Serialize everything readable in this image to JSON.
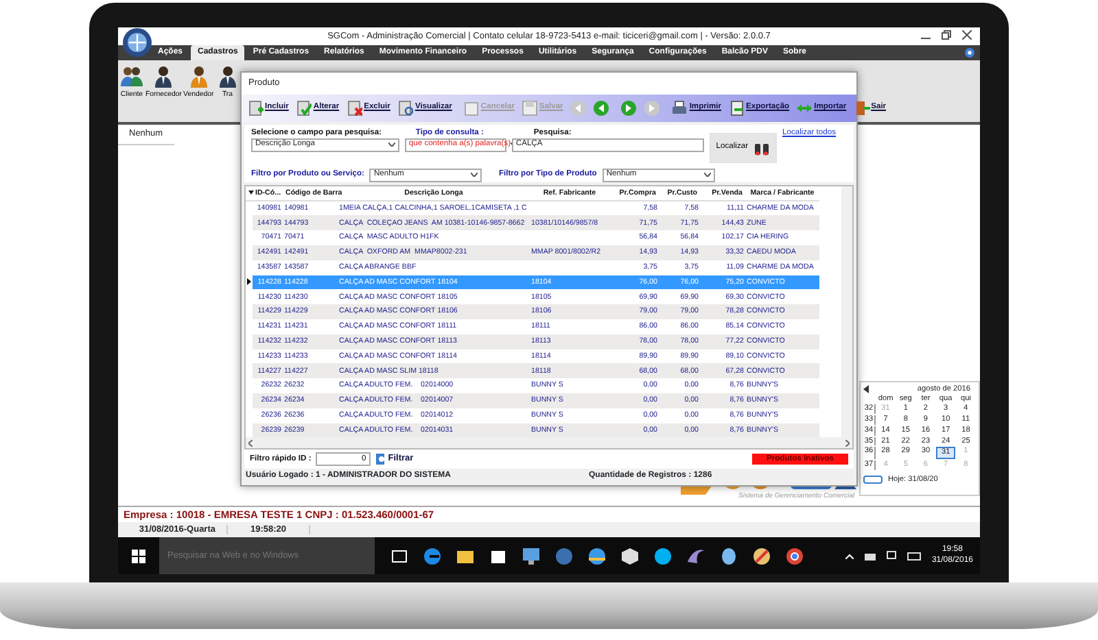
{
  "app": {
    "title": "SGCom - Administração Comercial | Contato celular 18-9723-5413 e-mail: ticiceri@gmail.com | - Versão: 2.0.0.7",
    "menu": [
      {
        "label": "Ações",
        "selected": false
      },
      {
        "label": "Cadastros",
        "selected": true
      },
      {
        "label": "Pré Cadastros",
        "selected": false
      },
      {
        "label": "Relatórios",
        "selected": false
      },
      {
        "label": "Movimento Financeiro",
        "selected": false
      },
      {
        "label": "Processos",
        "selected": false
      },
      {
        "label": "Utilitários",
        "selected": false
      },
      {
        "label": "Segurança",
        "selected": false
      },
      {
        "label": "Configurações",
        "selected": false
      },
      {
        "label": "Balcão PDV",
        "selected": false
      },
      {
        "label": "Sobre",
        "selected": false
      }
    ],
    "ribbon": [
      {
        "label": "Cliente",
        "kind": "people"
      },
      {
        "label": "Fornecedor",
        "kind": "person"
      },
      {
        "label": "Vendedor",
        "kind": "seller"
      },
      {
        "label": "Tra",
        "kind": "person"
      }
    ]
  },
  "mdi_label": "Nenhum",
  "product_window": {
    "title": "Produto",
    "toolbar": [
      {
        "kind": "add",
        "label": "Incluir",
        "disabled": false
      },
      {
        "kind": "edit",
        "label": "Alterar",
        "disabled": false
      },
      {
        "kind": "delete",
        "label": "Excluir",
        "disabled": false
      },
      {
        "kind": "view",
        "label": "Visualizar",
        "disabled": false
      },
      {
        "kind": "cancel",
        "label": "Cancelar",
        "disabled": true
      },
      {
        "kind": "save",
        "label": "Salvar",
        "disabled": true
      },
      {
        "kind": "first",
        "disabled": true
      },
      {
        "kind": "prev",
        "disabled": false
      },
      {
        "kind": "next",
        "disabled": false
      },
      {
        "kind": "last",
        "disabled": true
      },
      {
        "kind": "print",
        "label": "Imprimir",
        "disabled": false
      },
      {
        "kind": "export",
        "label": "Exportação",
        "disabled": false
      },
      {
        "kind": "import",
        "label": "Importar",
        "disabled": false
      },
      {
        "kind": "exit",
        "label": "Sair",
        "disabled": false
      }
    ],
    "search": {
      "field_label": "Selecione o campo para pesquisa:",
      "field_value": "Descrição Longa",
      "type_label": "Tipo de consulta :",
      "type_value": "que contenha a(s) palavra(s)",
      "query_label": "Pesquisa:",
      "query_value": "CALÇA",
      "find_button": "Localizar",
      "find_all_link": "Localizar todos",
      "filter1_label": "Filtro por Produto ou Serviço:",
      "filter1_value": "Nenhum",
      "filter2_label": "Filtro por Tipo de Produto",
      "filter2_value": "Nenhum"
    },
    "table": {
      "columns": [
        "ID-Có...",
        "Código de Barra",
        "Descrição Longa",
        "Ref. Fabricante",
        "Pr.Compra",
        "Pr.Custo",
        "Pr.Venda",
        "Marca / Fabricante"
      ],
      "rows": [
        {
          "selected": false,
          "cells": [
            "140981",
            "140981",
            "1MEIA CALÇA,1 CALCINHA,1 SAROEL,1CAMISETA ,1 C",
            "",
            "7,58",
            "7,58",
            "11,11",
            "CHARME DA MODA"
          ]
        },
        {
          "selected": false,
          "cells": [
            "144793",
            "144793",
            "CALÇA  COLEÇAO JEANS  AM 10381-10146-9857-8662",
            "10381/10146/9857/8",
            "71,75",
            "71,75",
            "144,43",
            "ZUNE"
          ]
        },
        {
          "selected": false,
          "cells": [
            "70471",
            "70471",
            "CALÇA  MASC ADULTO H1FK",
            "",
            "56,84",
            "56,84",
            "102,17",
            "CIA HERING"
          ]
        },
        {
          "selected": false,
          "cells": [
            "142491",
            "142491",
            "CALÇA  OXFORD AM  MMAP8002-231",
            "MMAP 8001/8002/R2",
            "14,93",
            "14,93",
            "33,32",
            "CAEDU MODA"
          ]
        },
        {
          "selected": false,
          "cells": [
            "143587",
            "143587",
            "CALÇA ABRANGE BBF",
            "",
            "3,75",
            "3,75",
            "11,09",
            "CHARME DA MODA"
          ]
        },
        {
          "selected": true,
          "cells": [
            "114228",
            "114228",
            "CALÇA AD MASC CONFORT 18104",
            "18104",
            "76,00",
            "76,00",
            "75,20",
            "CONVICTO"
          ]
        },
        {
          "selected": false,
          "cells": [
            "114230",
            "114230",
            "CALÇA AD MASC CONFORT 18105",
            "18105",
            "69,90",
            "69,90",
            "69,30",
            "CONVICTO"
          ]
        },
        {
          "selected": false,
          "cells": [
            "114229",
            "114229",
            "CALÇA AD MASC CONFORT 18106",
            "18106",
            "79,00",
            "79,00",
            "78,28",
            "CONVICTO"
          ]
        },
        {
          "selected": false,
          "cells": [
            "114231",
            "114231",
            "CALÇA AD MASC CONFORT 18111",
            "18111",
            "86,00",
            "86,00",
            "85,14",
            "CONVICTO"
          ]
        },
        {
          "selected": false,
          "cells": [
            "114232",
            "114232",
            "CALÇA AD MASC CONFORT 18113",
            "18113",
            "78,00",
            "78,00",
            "77,22",
            "CONVICTO"
          ]
        },
        {
          "selected": false,
          "cells": [
            "114233",
            "114233",
            "CALÇA AD MASC CONFORT 18114",
            "18114",
            "89,90",
            "89,90",
            "89,10",
            "CONVICTO"
          ]
        },
        {
          "selected": false,
          "cells": [
            "114227",
            "114227",
            "CALÇA AD MASC SLIM 18118",
            "18118",
            "68,00",
            "68,00",
            "67,28",
            "CONVICTO"
          ]
        },
        {
          "selected": false,
          "cells": [
            "26232",
            "26232",
            "CALÇA ADULTO FEM.    02014000",
            "BUNNY S",
            "0,00",
            "0,00",
            "8,76",
            "BUNNY'S"
          ]
        },
        {
          "selected": false,
          "cells": [
            "26234",
            "26234",
            "CALÇA ADULTO FEM.    02014007",
            "BUNNY S",
            "0,00",
            "0,00",
            "8,76",
            "BUNNY'S"
          ]
        },
        {
          "selected": false,
          "cells": [
            "26236",
            "26236",
            "CALÇA ADULTO FEM.    02014012",
            "BUNNY S",
            "0,00",
            "0,00",
            "8,76",
            "BUNNY'S"
          ]
        },
        {
          "selected": false,
          "cells": [
            "26239",
            "26239",
            "CALÇA ADULTO FEM.    02014031",
            "BUNNY S",
            "0,00",
            "0,00",
            "8,76",
            "BUNNY'S"
          ]
        }
      ]
    },
    "footer": {
      "quick_filter_label": "Filtro rápido ID :",
      "quick_filter_value": "0",
      "filter_button": "Filtrar",
      "inactive_button": "Produtos Inativos"
    },
    "status": {
      "user": "Usuário Logado : 1 - ADMINISTRADOR DO SISTEMA",
      "count": "Quantidade de Registros : 1286"
    }
  },
  "logo_subtitle": "Sistema de Gerenciamento Comercial",
  "calendar": {
    "month": "agosto de 2016",
    "weekdays": [
      "dom",
      "seg",
      "ter",
      "qua",
      "qui"
    ],
    "weeks": [
      {
        "number": "32",
        "days": [
          {
            "text": "31",
            "other_month": true,
            "selected": false
          },
          {
            "text": "1",
            "other_month": false,
            "selected": false
          },
          {
            "text": "2",
            "other_month": false,
            "selected": false
          },
          {
            "text": "3",
            "other_month": false,
            "selected": false
          },
          {
            "text": "4",
            "other_month": false,
            "selected": false
          }
        ]
      },
      {
        "number": "33",
        "days": [
          {
            "text": "7",
            "other_month": false,
            "selected": false
          },
          {
            "text": "8",
            "other_month": false,
            "selected": false
          },
          {
            "text": "9",
            "other_month": false,
            "selected": false
          },
          {
            "text": "10",
            "other_month": false,
            "selected": false
          },
          {
            "text": "11",
            "other_month": false,
            "selected": false
          }
        ]
      },
      {
        "number": "34",
        "days": [
          {
            "text": "14",
            "other_month": false,
            "selected": false
          },
          {
            "text": "15",
            "other_month": false,
            "selected": false
          },
          {
            "text": "16",
            "other_month": false,
            "selected": false
          },
          {
            "text": "17",
            "other_month": false,
            "selected": false
          },
          {
            "text": "18",
            "other_month": false,
            "selected": false
          }
        ]
      },
      {
        "number": "35",
        "days": [
          {
            "text": "21",
            "other_month": false,
            "selected": false
          },
          {
            "text": "22",
            "other_month": false,
            "selected": false
          },
          {
            "text": "23",
            "other_month": false,
            "selected": false
          },
          {
            "text": "24",
            "other_month": false,
            "selected": false
          },
          {
            "text": "25",
            "other_month": false,
            "selected": false
          }
        ]
      },
      {
        "number": "36",
        "days": [
          {
            "text": "28",
            "other_month": false,
            "selected": false
          },
          {
            "text": "29",
            "other_month": false,
            "selected": false
          },
          {
            "text": "30",
            "other_month": false,
            "selected": false
          },
          {
            "text": "31",
            "other_month": false,
            "selected": true
          },
          {
            "text": "1",
            "other_month": true,
            "selected": false
          }
        ]
      },
      {
        "number": "37",
        "days": [
          {
            "text": "4",
            "other_month": true,
            "selected": false
          },
          {
            "text": "5",
            "other_month": true,
            "selected": false
          },
          {
            "text": "6",
            "other_month": true,
            "selected": false
          },
          {
            "text": "7",
            "other_month": true,
            "selected": false
          },
          {
            "text": "8",
            "other_month": true,
            "selected": false
          }
        ]
      }
    ],
    "today": "Hoje: 31/08/20"
  },
  "status_bar": {
    "company": "Empresa : 10018 - EMRESA TESTE 1  CNPJ : 01.523.460/0001-67",
    "date": "31/08/2016-Quarta",
    "time": "19:58:20"
  },
  "taskbar": {
    "search_placeholder": "Pesquisar na Web e no Windows",
    "time": "19:58",
    "date": "31/08/2016"
  }
}
